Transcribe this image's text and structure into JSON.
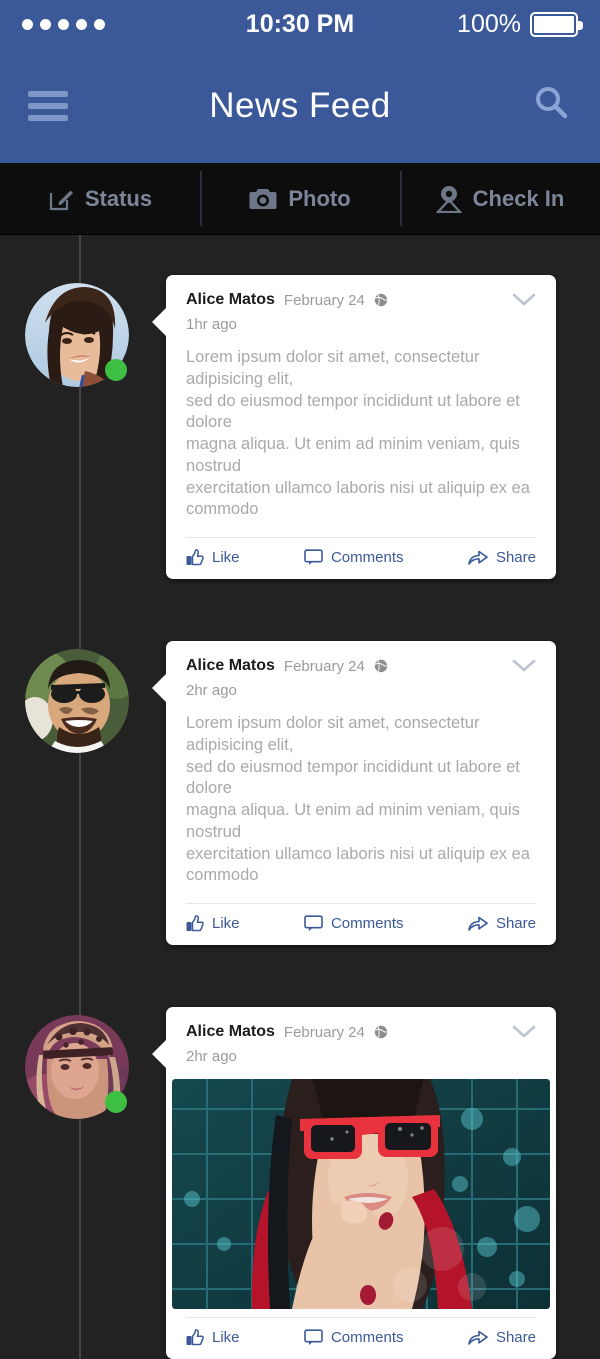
{
  "status_bar": {
    "signal_dots": 5,
    "time": "10:30 PM",
    "battery_percent": "100%"
  },
  "header": {
    "title": "News Feed",
    "menu_icon": "hamburger-icon",
    "search_icon": "search-icon",
    "background_color": "#3b5998"
  },
  "action_bar": {
    "items": [
      {
        "label": "Status",
        "icon": "compose-icon"
      },
      {
        "label": "Photo",
        "icon": "camera-icon"
      },
      {
        "label": "Check In",
        "icon": "location-pin-icon"
      }
    ]
  },
  "feed": {
    "posts": [
      {
        "author": "Alice Matos",
        "date": "February 24",
        "privacy_icon": "globe-icon",
        "time_ago": "1hr ago",
        "text": "Lorem ipsum dolor sit amet, consectetur adipisicing elit,\nsed do eiusmod tempor incididunt ut labore et dolore\nmagna aliqua. Ut enim ad minim veniam, quis nostrud\nexercitation ullamco laboris nisi ut aliquip ex ea commodo",
        "online": true,
        "avatar": "woman-dark-hair",
        "has_photo": false,
        "actions": {
          "like": "Like",
          "comments": "Comments",
          "share": "Share"
        }
      },
      {
        "author": "Alice Matos",
        "date": "February 24",
        "privacy_icon": "globe-icon",
        "time_ago": "2hr ago",
        "text": "Lorem ipsum dolor sit amet, consectetur adipisicing elit,\nsed do eiusmod tempor incididunt ut labore et dolore\nmagna aliqua. Ut enim ad minim veniam, quis nostrud\nexercitation ullamco laboris nisi ut aliquip ex ea commodo",
        "online": false,
        "avatar": "man-sunglasses-beard",
        "has_photo": false,
        "actions": {
          "like": "Like",
          "comments": "Comments",
          "share": "Share"
        }
      },
      {
        "author": "Alice Matos",
        "date": "February 24",
        "privacy_icon": "globe-icon",
        "time_ago": "2hr ago",
        "text": "",
        "online": true,
        "avatar": "woman-leopard-headband",
        "has_photo": true,
        "photo_alt": "woman-red-sunglasses",
        "actions": {
          "like": "Like",
          "comments": "Comments",
          "share": "Share"
        }
      }
    ]
  },
  "colors": {
    "brand_blue": "#3b5998",
    "background": "#222222",
    "action_bar": "#0d0d0d",
    "card": "#ffffff",
    "online_green": "#3dbf42",
    "body_text": "#a9a9a9",
    "muted_text": "#9b9b9b"
  }
}
